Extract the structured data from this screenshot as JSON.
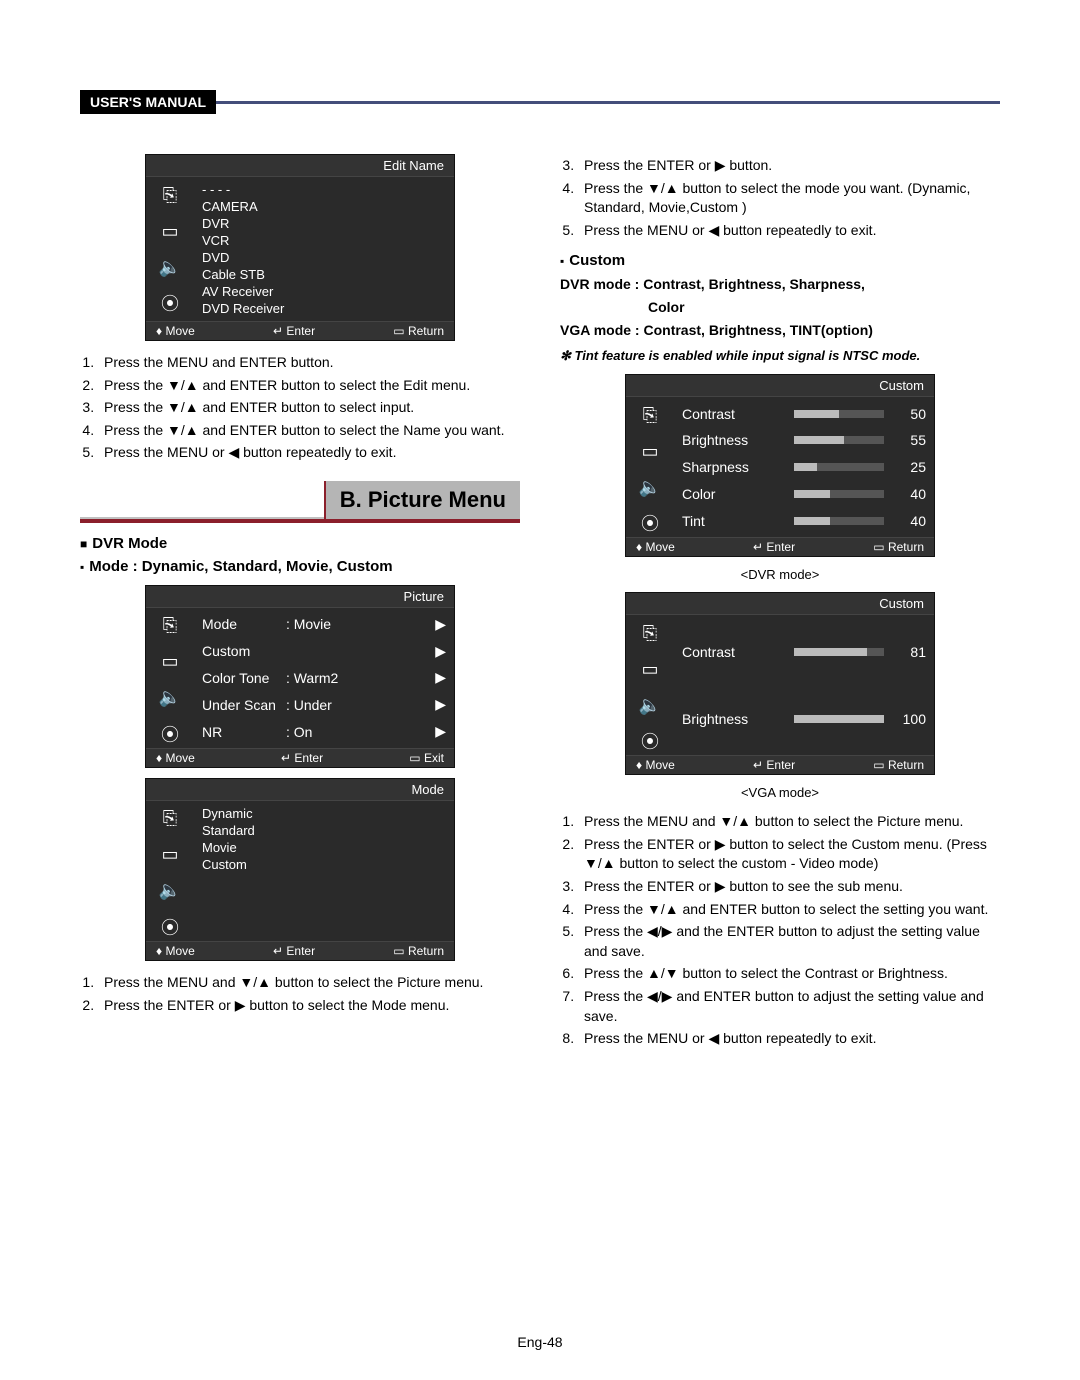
{
  "header": {
    "label": "USER'S MANUAL"
  },
  "editNameMenu": {
    "title": "Edit Name",
    "dashes": "- - - -",
    "items": [
      "CAMERA",
      "DVR",
      "VCR",
      "DVD",
      "Cable STB",
      "AV Receiver",
      "DVD Receiver"
    ],
    "footer": {
      "move": "Move",
      "enter": "Enter",
      "return": "Return"
    }
  },
  "editSteps": [
    "Press the MENU and ENTER button.",
    "Press the ▼/▲ and ENTER button to select the Edit menu.",
    "Press the ▼/▲ and ENTER button to select input.",
    "Press the ▼/▲ and ENTER button to select the Name you want.",
    "Press the MENU or ◀ button repeatedly to exit."
  ],
  "sectionB": {
    "title": "B. Picture Menu"
  },
  "dvrHead": {
    "h1": "DVR Mode",
    "h2": "Mode : Dynamic, Standard, Movie,  Custom"
  },
  "pictureMenu": {
    "title": "Picture",
    "rows": [
      {
        "label": "Mode",
        "value": ": Movie"
      },
      {
        "label": "Custom",
        "value": ""
      },
      {
        "label": "Color Tone",
        "value": ": Warm2"
      },
      {
        "label": "Under Scan",
        "value": ": Under"
      },
      {
        "label": "NR",
        "value": ": On"
      }
    ],
    "footer": {
      "move": "Move",
      "enter": "Enter",
      "exit": "Exit"
    }
  },
  "modeMenu": {
    "title": "Mode",
    "items": [
      "Dynamic",
      "Standard",
      "Movie",
      "Custom"
    ],
    "footer": {
      "move": "Move",
      "enter": "Enter",
      "return": "Return"
    }
  },
  "modeSteps12": [
    "Press the MENU and ▼/▲ button to select the Picture menu.",
    "Press  the ENTER or ▶ button to select the Mode menu."
  ],
  "modeSteps345": [
    "Press  the ENTER or ▶ button.",
    "Press the ▼/▲ button to select the mode you want. (Dynamic, Standard, Movie,Custom )",
    "Press the MENU or ◀ button repeatedly to exit."
  ],
  "customHead": {
    "h1": "Custom",
    "line1": "DVR mode : Contrast, Brightness, Sharpness,",
    "line1b": "Color",
    "line2": "VGA mode  : Contrast, Brightness, TINT(option)"
  },
  "tintNote": "✻ Tint feature is enabled while input signal is NTSC mode.",
  "customDvr": {
    "title": "Custom",
    "rows": [
      {
        "label": "Contrast",
        "value": "50",
        "pct": 50
      },
      {
        "label": "Brightness",
        "value": "55",
        "pct": 55
      },
      {
        "label": "Sharpness",
        "value": "25",
        "pct": 25
      },
      {
        "label": "Color",
        "value": "40",
        "pct": 40
      },
      {
        "label": "Tint",
        "value": "40",
        "pct": 40
      }
    ],
    "footer": {
      "move": "Move",
      "enter": "Enter",
      "return": "Return"
    },
    "caption": "<DVR mode>"
  },
  "customVga": {
    "title": "Custom",
    "rows": [
      {
        "label": "Contrast",
        "value": "81",
        "pct": 81
      },
      {
        "label": "Brightness",
        "value": "100",
        "pct": 100
      }
    ],
    "footer": {
      "move": "Move",
      "enter": "Enter",
      "return": "Return"
    },
    "caption": "<VGA mode>"
  },
  "customSteps": [
    "Press the MENU and ▼/▲ button to select the Picture menu.",
    "Press the ENTER or ▶ button to select the Custom menu. (Press ▼/▲ button to select the custom - Video mode)",
    "Press the ENTER or ▶ button to see the sub menu.",
    "Press the ▼/▲ and ENTER button to select the setting you want.",
    "Press the ◀/▶ and the ENTER button to adjust the setting value and save.",
    "Press the ▲/▼ button to select the Contrast or Brightness.",
    "Press the ◀/▶ and ENTER button to adjust the setting value and save.",
    "Press the MENU or ◀ button repeatedly to exit."
  ],
  "pageNum": "Eng-48",
  "icons": {
    "source": "⎆",
    "picture": "▭",
    "sound": "🔊",
    "setup": "⚙"
  },
  "foot": {
    "moveSym": "♦",
    "enterSym": "↵",
    "menuSym": "▭"
  }
}
